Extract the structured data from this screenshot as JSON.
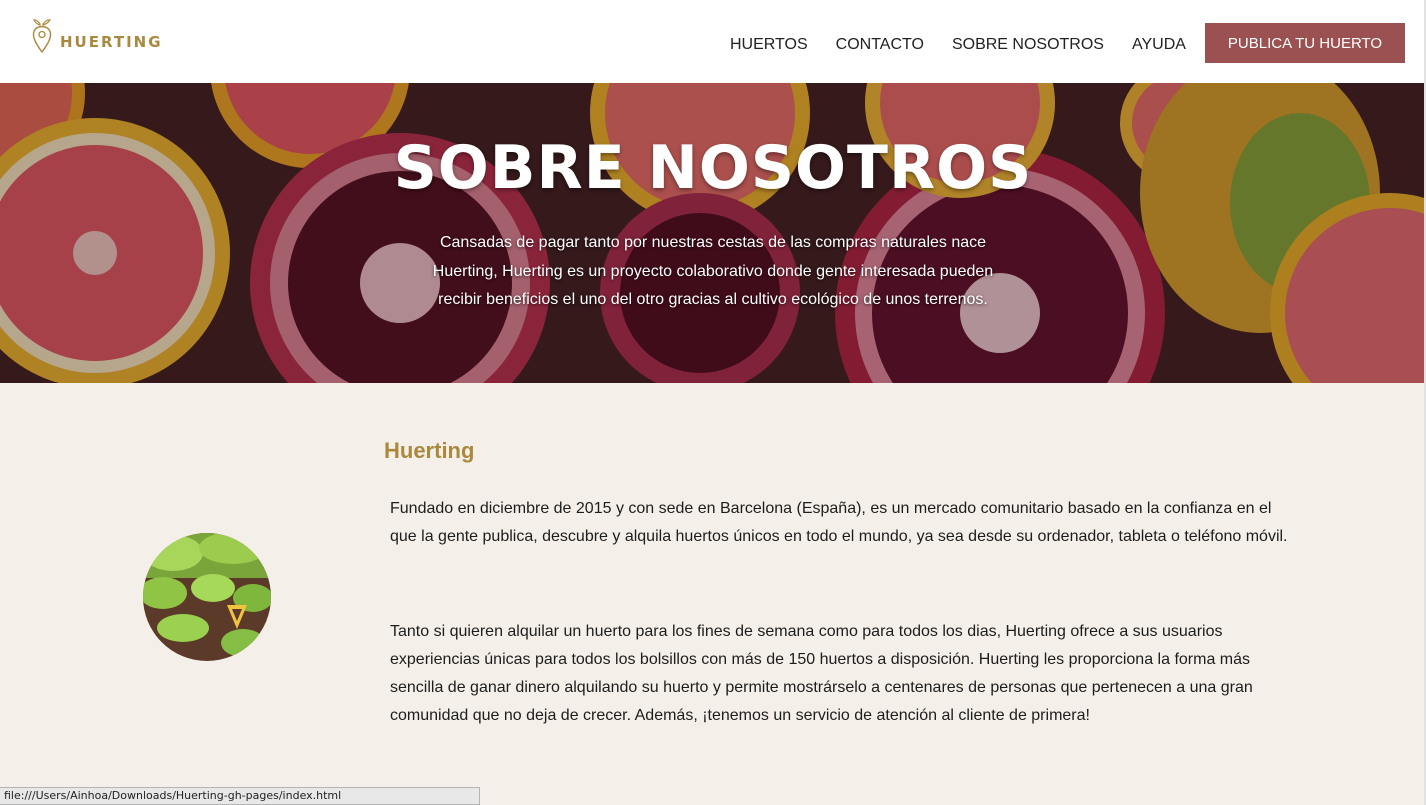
{
  "header": {
    "logo_text": "HUERTING",
    "nav": [
      "HUERTOS",
      "CONTACTO",
      "SOBRE NOSOTROS",
      "AYUDA"
    ],
    "cta_label": "PUBLICA TU HUERTO"
  },
  "hero": {
    "title": "SOBRE NOSOTROS",
    "text": "Cansadas de pagar tanto por nuestras cestas de las compras naturales nace Huerting, Huerting es un proyecto colaborativo donde gente interesada pueden recibir beneficios el uno del otro gracias al cultivo ecológico de unos terrenos."
  },
  "about": {
    "title": "Huerting",
    "paragraph1": "Fundado en diciembre de 2015 y con sede en Barcelona (España), es un mercado comunitario basado en la confianza en el que la gente publica, descubre y alquila huertos únicos en todo el mundo, ya sea desde su ordenador, tableta o teléfono móvil.",
    "paragraph2": "Tanto si quieren alquilar un huerto para los fines de semana como para todos los dias, Huerting ofrece a sus usuarios experiencias únicas para todos los bolsillos con más de 150 huertos a disposición. Huerting les proporciona la forma más sencilla de ganar dinero alquilando su huerto y permite mostrárselo a centenares de personas que pertenecen a una gran comunidad que no deja de crecer. Además, ¡tenemos un servicio de atención al cliente de primera!"
  },
  "status_bar": {
    "url": "file:///Users/Ainhoa/Downloads/Huerting-gh-pages/index.html"
  },
  "colors": {
    "accent_gold": "#a9893d",
    "cta_bg": "#9b5151",
    "page_bg": "#f4f0e9"
  }
}
